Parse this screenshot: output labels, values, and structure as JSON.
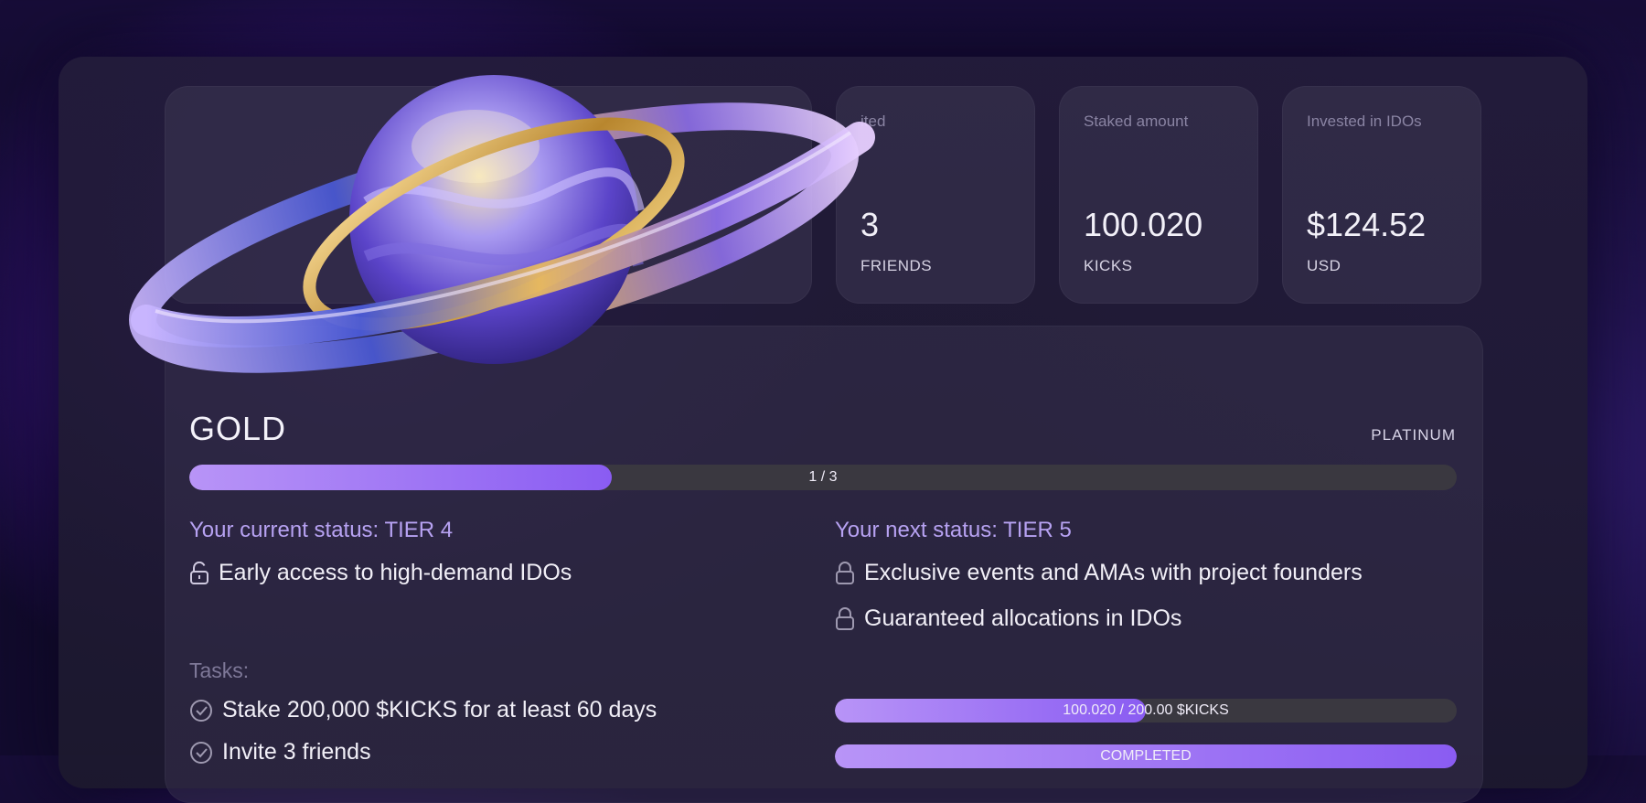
{
  "stats": [
    {
      "label": "ited",
      "value": "3",
      "unit": "FRIENDS"
    },
    {
      "label": "Staked amount",
      "value": "100.020",
      "unit": "KICKS"
    },
    {
      "label": "Invested in IDOs",
      "value": "$124.52",
      "unit": "USD"
    }
  ],
  "tier": {
    "current_name": "GOLD",
    "next_name": "PLATINUM",
    "progress_text": "1 / 3",
    "progress_fraction": 0.333
  },
  "current_status": {
    "heading": "Your current status: TIER 4",
    "perks": [
      "Early access to high-demand IDOs"
    ]
  },
  "next_status": {
    "heading": "Your next status: TIER 5",
    "perks": [
      "Exclusive events and AMAs with project founders",
      "Guaranteed allocations in IDOs"
    ]
  },
  "tasks": {
    "label": "Tasks:",
    "items": [
      {
        "text": "Stake 200,000 $KICKS for at least 60 days",
        "progress_text": "100.020 / 200.00 $KICKS",
        "progress_fraction": 0.5
      },
      {
        "text": "Invite 3 friends",
        "progress_text": "COMPLETED",
        "progress_fraction": 1.0
      }
    ]
  },
  "colors": {
    "accent": "#8a5cf2",
    "accent_light": "#b894f7",
    "status_heading": "#b7a2f2"
  },
  "icons": {
    "perk_current": "unlocked-lock-icon",
    "perk_next": "lock-icon",
    "task": "check-circle-icon"
  }
}
